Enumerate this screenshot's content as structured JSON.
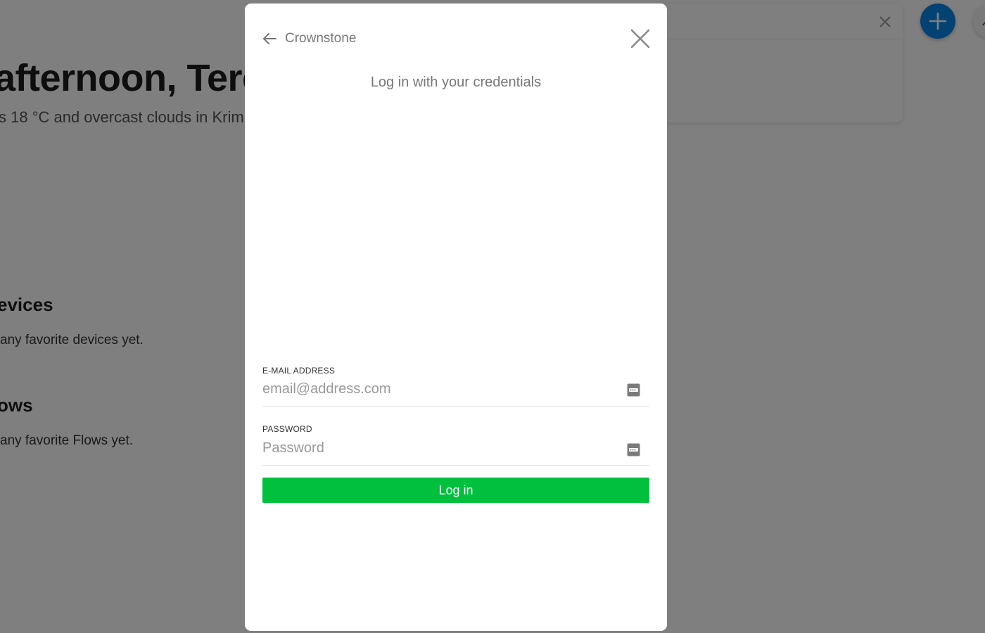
{
  "background": {
    "greeting": "afternoon, Tere",
    "weather": "s 18 °C and overcast clouds in Krim",
    "devices_title": "evices",
    "devices_empty": "any favorite devices yet.",
    "flows_title": "ows",
    "flows_empty": "any favorite Flows yet.",
    "accent_color": "#0a84e8"
  },
  "modal": {
    "title": "Crownstone",
    "subtitle": "Log in with your credentials",
    "email": {
      "label": "E-MAIL ADDRESS",
      "placeholder": "email@address.com",
      "value": ""
    },
    "password": {
      "label": "PASSWORD",
      "placeholder": "Password",
      "value": ""
    },
    "login_label": "Log in",
    "login_color": "#00c03e"
  },
  "icons": {
    "back": "arrow-left-icon",
    "close": "close-icon",
    "password_manager": "password-manager-icon",
    "add": "plus-icon",
    "search_close": "close-icon"
  }
}
